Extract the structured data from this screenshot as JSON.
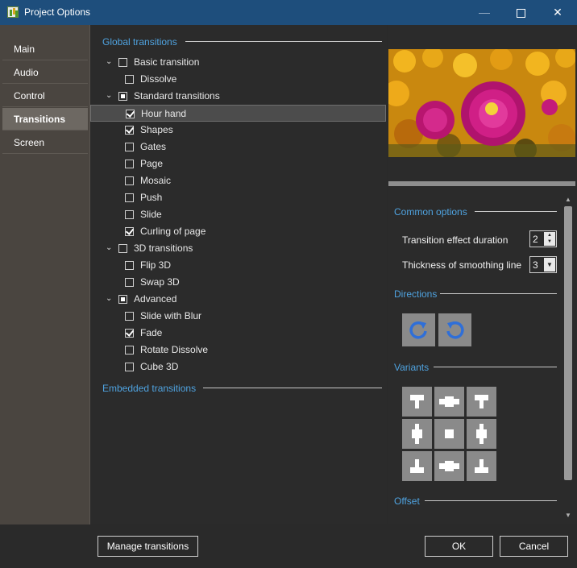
{
  "window": {
    "title": "Project Options"
  },
  "sidebar": {
    "items": [
      {
        "label": "Main"
      },
      {
        "label": "Audio"
      },
      {
        "label": "Control"
      },
      {
        "label": "Transitions",
        "active": true
      },
      {
        "label": "Screen"
      }
    ]
  },
  "global_transitions": {
    "heading": "Global transitions",
    "tree": [
      {
        "label": "Basic transition",
        "level": 0,
        "expanded": true,
        "state": "unchecked"
      },
      {
        "label": "Dissolve",
        "level": 1,
        "state": "unchecked"
      },
      {
        "label": "Standard transitions",
        "level": 0,
        "expanded": true,
        "state": "partial"
      },
      {
        "label": "Hour hand",
        "level": 1,
        "state": "checked",
        "selected": true
      },
      {
        "label": "Shapes",
        "level": 1,
        "state": "checked"
      },
      {
        "label": "Gates",
        "level": 1,
        "state": "unchecked"
      },
      {
        "label": "Page",
        "level": 1,
        "state": "unchecked"
      },
      {
        "label": "Mosaic",
        "level": 1,
        "state": "unchecked"
      },
      {
        "label": "Push",
        "level": 1,
        "state": "unchecked"
      },
      {
        "label": "Slide",
        "level": 1,
        "state": "unchecked"
      },
      {
        "label": "Curling of page",
        "level": 1,
        "state": "checked"
      },
      {
        "label": "3D transitions",
        "level": 0,
        "expanded": true,
        "state": "unchecked"
      },
      {
        "label": "Flip 3D",
        "level": 1,
        "state": "unchecked"
      },
      {
        "label": "Swap 3D",
        "level": 1,
        "state": "unchecked"
      },
      {
        "label": "Advanced",
        "level": 0,
        "expanded": true,
        "state": "partial"
      },
      {
        "label": "Slide with Blur",
        "level": 1,
        "state": "unchecked"
      },
      {
        "label": "Fade",
        "level": 1,
        "state": "checked"
      },
      {
        "label": "Rotate Dissolve",
        "level": 1,
        "state": "unchecked"
      },
      {
        "label": "Cube 3D",
        "level": 1,
        "state": "unchecked"
      }
    ]
  },
  "embedded_transitions": {
    "heading": "Embedded transitions"
  },
  "options": {
    "common_heading": "Common options",
    "duration_label": "Transition effect duration",
    "duration_value": "2",
    "smoothing_label": "Thickness of smoothing line",
    "smoothing_value": "3",
    "directions_heading": "Directions",
    "variants_heading": "Variants",
    "offset_heading": "Offset"
  },
  "buttons": {
    "manage": "Manage transitions",
    "ok": "OK",
    "cancel": "Cancel"
  },
  "colors": {
    "accent": "#4fa3e0",
    "titlebar": "#1e4e7c",
    "direction_icon": "#2f6fd8"
  }
}
